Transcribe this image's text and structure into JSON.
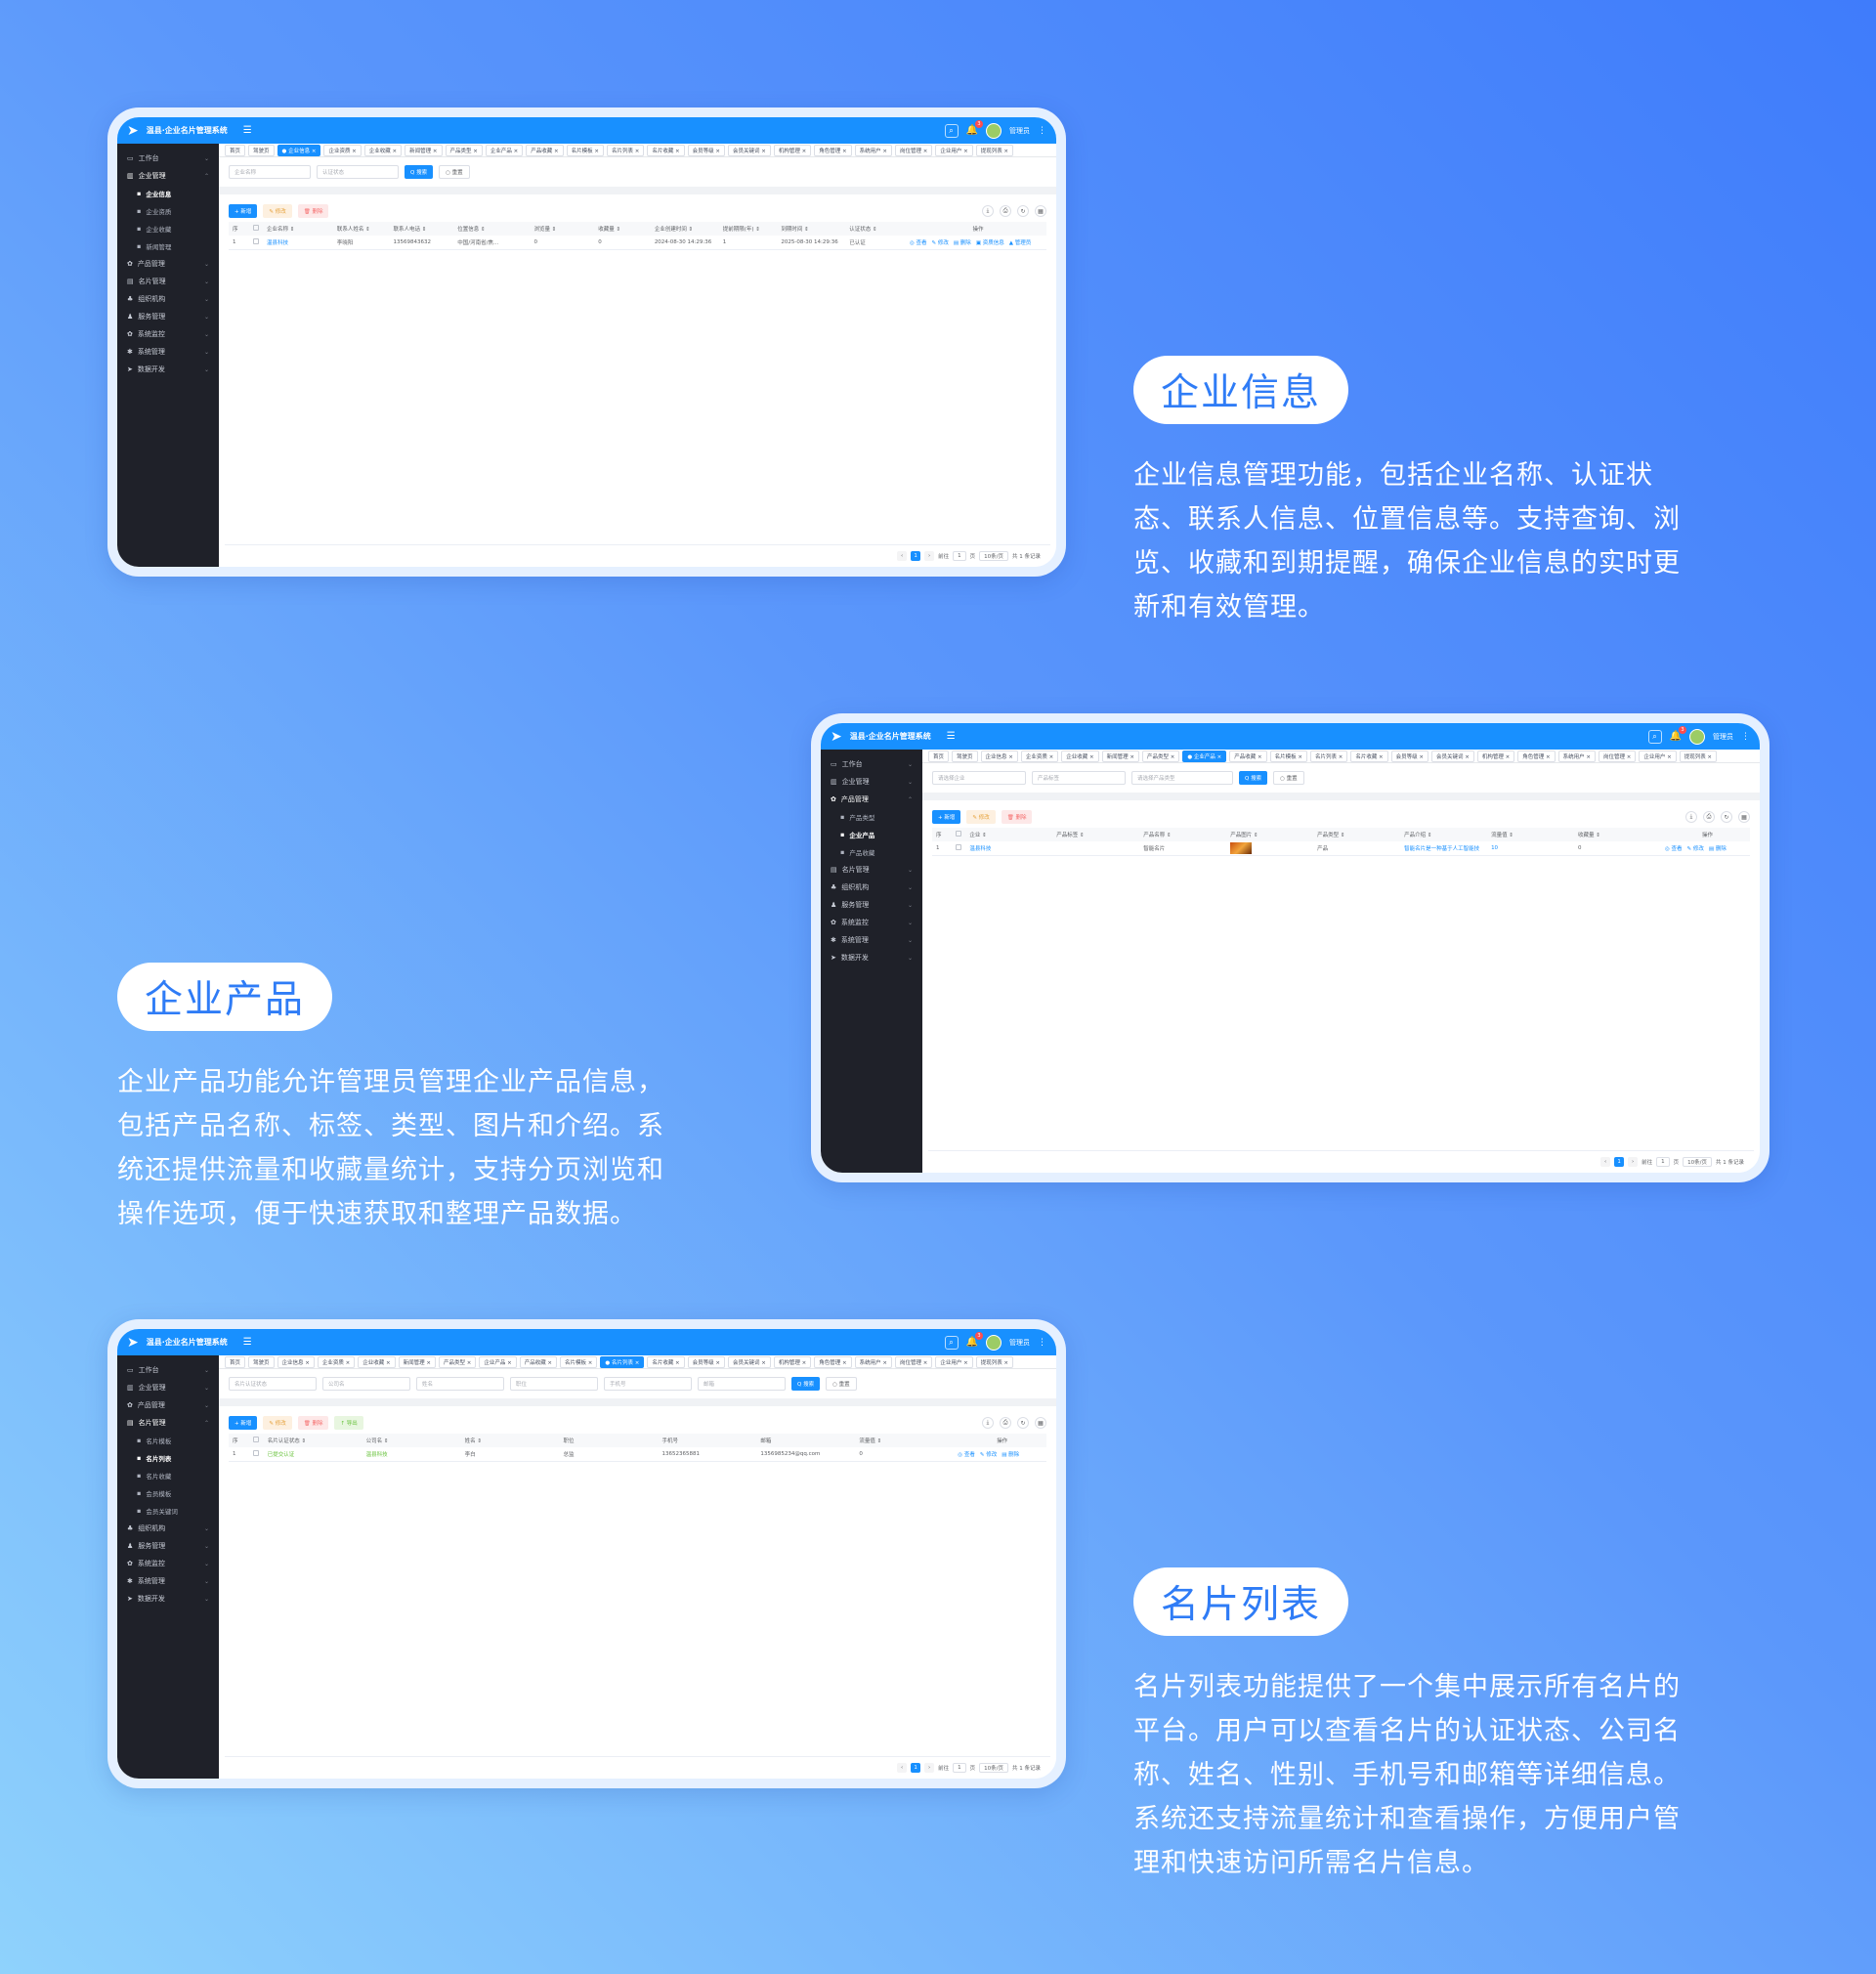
{
  "app": {
    "system_name": "温县·企业名片管理系统",
    "user_name": "管理员",
    "notif_count": "3",
    "brand_color": "#1890ff",
    "sidebar_color": "#1f2129"
  },
  "sections": [
    {
      "title": "企业信息",
      "description": "企业信息管理功能，包括企业名称、认证状态、联系人信息、位置信息等。支持查询、浏览、收藏和到期提醒，确保企业信息的实时更新和有效管理。"
    },
    {
      "title": "企业产品",
      "description": "企业产品功能允许管理员管理企业产品信息，包括产品名称、标签、类型、图片和介绍。系统还提供流量和收藏量统计，支持分页浏览和操作选项，便于快速获取和整理产品数据。"
    },
    {
      "title": "名片列表",
      "description": "名片列表功能提供了一个集中展示所有名片的平台。用户可以查看名片的认证状态、公司名称、姓名、性别、手机号和邮箱等详细信息。系统还支持流量统计和查看操作，方便用户管理和快速访问所需名片信息。"
    }
  ],
  "screens": [
    {
      "sidebar": [
        {
          "label": "工作台",
          "icon": "monitor-icon",
          "active": false
        },
        {
          "label": "企业管理",
          "icon": "building-icon",
          "active": true,
          "children": [
            {
              "label": "企业信息",
              "active": true
            },
            {
              "label": "企业资质",
              "active": false
            },
            {
              "label": "企业收藏",
              "active": false
            },
            {
              "label": "新闻管理",
              "active": false
            }
          ]
        },
        {
          "label": "产品管理",
          "icon": "gear-icon",
          "active": false
        },
        {
          "label": "名片管理",
          "icon": "card-icon",
          "active": false
        },
        {
          "label": "组织机构",
          "icon": "org-icon",
          "active": false
        },
        {
          "label": "服务管理",
          "icon": "service-icon",
          "active": false
        },
        {
          "label": "系统监控",
          "icon": "gear-icon",
          "active": false
        },
        {
          "label": "系统管理",
          "icon": "settings-icon",
          "active": false
        },
        {
          "label": "数据开发",
          "icon": "send-icon",
          "active": false
        }
      ],
      "tabs": [
        {
          "label": "首页",
          "active": false
        },
        {
          "label": "驾驶页",
          "active": false
        },
        {
          "label": "● 企业信息 ×",
          "active": true
        },
        {
          "label": "企业资质 ×",
          "active": false
        },
        {
          "label": "企业收藏 ×",
          "active": false
        },
        {
          "label": "新闻管理 ×",
          "active": false
        },
        {
          "label": "产品类型 ×",
          "active": false
        },
        {
          "label": "企业产品 ×",
          "active": false
        },
        {
          "label": "产品收藏 ×",
          "active": false
        },
        {
          "label": "名片模板 ×",
          "active": false
        },
        {
          "label": "名片列表 ×",
          "active": false
        },
        {
          "label": "名片收藏 ×",
          "active": false
        },
        {
          "label": "会员等级 ×",
          "active": false
        },
        {
          "label": "会员关键词 ×",
          "active": false
        },
        {
          "label": "机构管理 ×",
          "active": false
        },
        {
          "label": "角色管理 ×",
          "active": false
        },
        {
          "label": "系统用户 ×",
          "active": false
        },
        {
          "label": "岗位管理 ×",
          "active": false
        },
        {
          "label": "企业用户 ×",
          "active": false
        },
        {
          "label": "提现列表 ×",
          "active": false
        }
      ],
      "search_fields": [
        {
          "placeholder": "企业名称",
          "width": 84
        },
        {
          "placeholder": "认证状态",
          "width": 84
        }
      ],
      "search_label": "Q 搜索",
      "reset_label": "○ 重置",
      "toolbar_buttons": [
        {
          "label": "+ 新增",
          "kind": "add"
        },
        {
          "label": "✎ 修改",
          "kind": "warn"
        },
        {
          "label": "🗑 删除",
          "kind": "danger"
        }
      ],
      "columns": [
        {
          "label": "序",
          "w": 20
        },
        {
          "label": "",
          "w": 14,
          "check": true
        },
        {
          "label": "企业名称 ⇕",
          "w": 70
        },
        {
          "label": "联系人姓名 ⇕",
          "w": 56
        },
        {
          "label": "联系人电话 ⇕",
          "w": 64
        },
        {
          "label": "位置信息 ⇕",
          "w": 76
        },
        {
          "label": "浏览量 ⇕",
          "w": 64
        },
        {
          "label": "收藏量 ⇕",
          "w": 56
        },
        {
          "label": "企业创建时间 ⇕",
          "w": 68
        },
        {
          "label": "提前期限(年) ⇕",
          "w": 58
        },
        {
          "label": "到期时间 ⇕",
          "w": 68
        },
        {
          "label": "认证状态 ⇕",
          "w": 60
        },
        {
          "label": "操作",
          "w": 140,
          "center": true
        }
      ],
      "rows": [
        {
          "cells": [
            {
              "v": "1"
            },
            {
              "check": true
            },
            {
              "v": "温县科技",
              "cls": "link"
            },
            {
              "v": "李晓阳"
            },
            {
              "v": "13569843632"
            },
            {
              "v": "中国/河南省/焦..."
            },
            {
              "v": "0"
            },
            {
              "v": "0"
            },
            {
              "v": "2024-08-30 14:29:36"
            },
            {
              "v": "1"
            },
            {
              "v": "2025-08-30 14:29:36"
            },
            {
              "v": "已认证"
            },
            {
              "ops": [
                "◎ 查看",
                "✎ 修改",
                "▤ 删除",
                "▣ 资质信息",
                "▲ 管理员"
              ]
            }
          ]
        }
      ],
      "pager": {
        "current": "1",
        "goto_label": "前往",
        "goto_value": "1",
        "page_unit": "页",
        "page_size": "10条/页",
        "total": "共 1 条记录"
      }
    },
    {
      "sidebar": [
        {
          "label": "工作台",
          "icon": "monitor-icon",
          "active": false
        },
        {
          "label": "企业管理",
          "icon": "building-icon",
          "active": false
        },
        {
          "label": "产品管理",
          "icon": "gear-icon",
          "active": true,
          "children": [
            {
              "label": "产品类型",
              "active": false
            },
            {
              "label": "企业产品",
              "active": true
            },
            {
              "label": "产品收藏",
              "active": false
            }
          ]
        },
        {
          "label": "名片管理",
          "icon": "card-icon",
          "active": false
        },
        {
          "label": "组织机构",
          "icon": "org-icon",
          "active": false
        },
        {
          "label": "服务管理",
          "icon": "service-icon",
          "active": false
        },
        {
          "label": "系统监控",
          "icon": "gear-icon",
          "active": false
        },
        {
          "label": "系统管理",
          "icon": "settings-icon",
          "active": false
        },
        {
          "label": "数据开发",
          "icon": "send-icon",
          "active": false
        }
      ],
      "tabs": [
        {
          "label": "首页",
          "active": false
        },
        {
          "label": "驾驶页",
          "active": false
        },
        {
          "label": "企业信息 ×",
          "active": false
        },
        {
          "label": "企业资质 ×",
          "active": false
        },
        {
          "label": "企业收藏 ×",
          "active": false
        },
        {
          "label": "新闻管理 ×",
          "active": false
        },
        {
          "label": "产品类型 ×",
          "active": false
        },
        {
          "label": "● 企业产品 ×",
          "active": true
        },
        {
          "label": "产品收藏 ×",
          "active": false
        },
        {
          "label": "名片模板 ×",
          "active": false
        },
        {
          "label": "名片列表 ×",
          "active": false
        },
        {
          "label": "名片收藏 ×",
          "active": false
        },
        {
          "label": "会员等级 ×",
          "active": false
        },
        {
          "label": "会员关键词 ×",
          "active": false
        },
        {
          "label": "机构管理 ×",
          "active": false
        },
        {
          "label": "角色管理 ×",
          "active": false
        },
        {
          "label": "系统用户 ×",
          "active": false
        },
        {
          "label": "岗位管理 ×",
          "active": false
        },
        {
          "label": "企业用户 ×",
          "active": false
        },
        {
          "label": "提现列表 ×",
          "active": false
        }
      ],
      "search_fields": [
        {
          "placeholder": "请选择企业",
          "width": 96
        },
        {
          "placeholder": "产品标签",
          "width": 96
        },
        {
          "placeholder": "请选择产品类型",
          "width": 104
        }
      ],
      "search_label": "Q 搜索",
      "reset_label": "○ 重置",
      "toolbar_buttons": [
        {
          "label": "+ 新增",
          "kind": "add"
        },
        {
          "label": "✎ 修改",
          "kind": "warn"
        },
        {
          "label": "🗑 删除",
          "kind": "danger"
        }
      ],
      "columns": [
        {
          "label": "序",
          "w": 20
        },
        {
          "label": "",
          "w": 14,
          "check": true
        },
        {
          "label": "企业 ⇕",
          "w": 88
        },
        {
          "label": "产品标签 ⇕",
          "w": 88
        },
        {
          "label": "产品名称 ⇕",
          "w": 88
        },
        {
          "label": "产品图片 ⇕",
          "w": 88
        },
        {
          "label": "产品类型 ⇕",
          "w": 88
        },
        {
          "label": "产品介绍 ⇕",
          "w": 88
        },
        {
          "label": "流量值 ⇕",
          "w": 88
        },
        {
          "label": "收藏量 ⇕",
          "w": 88
        },
        {
          "label": "操作",
          "w": 90,
          "center": true
        }
      ],
      "rows": [
        {
          "cells": [
            {
              "v": "1"
            },
            {
              "check": true
            },
            {
              "v": "温县科技",
              "cls": "link"
            },
            {
              "v": ""
            },
            {
              "v": "智能名片"
            },
            {
              "thumb": true
            },
            {
              "v": "产品"
            },
            {
              "v": "智能名片是一种基于人工智能技",
              "cls": "link"
            },
            {
              "v": "10",
              "cls": "link"
            },
            {
              "v": "0"
            },
            {
              "ops": [
                "◎ 查看",
                "✎ 修改",
                "▤ 删除"
              ]
            }
          ]
        }
      ],
      "pager": {
        "current": "1",
        "goto_label": "前往",
        "goto_value": "1",
        "page_unit": "页",
        "page_size": "10条/页",
        "total": "共 1 条记录"
      }
    },
    {
      "sidebar": [
        {
          "label": "工作台",
          "icon": "monitor-icon",
          "active": false
        },
        {
          "label": "企业管理",
          "icon": "building-icon",
          "active": false
        },
        {
          "label": "产品管理",
          "icon": "gear-icon",
          "active": false
        },
        {
          "label": "名片管理",
          "icon": "card-icon",
          "active": true,
          "children": [
            {
              "label": "名片模板",
              "active": false
            },
            {
              "label": "名片列表",
              "active": true
            },
            {
              "label": "名片收藏",
              "active": false
            },
            {
              "label": "会员模板",
              "active": false
            },
            {
              "label": "会员关键词",
              "active": false
            }
          ]
        },
        {
          "label": "组织机构",
          "icon": "org-icon",
          "active": false
        },
        {
          "label": "服务管理",
          "icon": "service-icon",
          "active": false
        },
        {
          "label": "系统监控",
          "icon": "gear-icon",
          "active": false
        },
        {
          "label": "系统管理",
          "icon": "settings-icon",
          "active": false
        },
        {
          "label": "数据开发",
          "icon": "send-icon",
          "active": false
        }
      ],
      "tabs": [
        {
          "label": "首页",
          "active": false
        },
        {
          "label": "驾驶页",
          "active": false
        },
        {
          "label": "企业信息 ×",
          "active": false
        },
        {
          "label": "企业资质 ×",
          "active": false
        },
        {
          "label": "企业收藏 ×",
          "active": false
        },
        {
          "label": "新闻管理 ×",
          "active": false
        },
        {
          "label": "产品类型 ×",
          "active": false
        },
        {
          "label": "企业产品 ×",
          "active": false
        },
        {
          "label": "产品收藏 ×",
          "active": false
        },
        {
          "label": "名片模板 ×",
          "active": false
        },
        {
          "label": "● 名片列表 ×",
          "active": true
        },
        {
          "label": "名片收藏 ×",
          "active": false
        },
        {
          "label": "会员等级 ×",
          "active": false
        },
        {
          "label": "会员关键词 ×",
          "active": false
        },
        {
          "label": "机构管理 ×",
          "active": false
        },
        {
          "label": "角色管理 ×",
          "active": false
        },
        {
          "label": "系统用户 ×",
          "active": false
        },
        {
          "label": "岗位管理 ×",
          "active": false
        },
        {
          "label": "企业用户 ×",
          "active": false
        },
        {
          "label": "提现列表 ×",
          "active": false
        }
      ],
      "search_fields": [
        {
          "placeholder": "名片认证状态",
          "width": 90
        },
        {
          "placeholder": "公司名",
          "width": 90
        },
        {
          "placeholder": "姓名",
          "width": 90
        },
        {
          "placeholder": "职位",
          "width": 90
        },
        {
          "placeholder": "手机号",
          "width": 90
        },
        {
          "placeholder": "邮箱",
          "width": 90
        }
      ],
      "search_label": "Q 搜索",
      "reset_label": "○ 重置",
      "toolbar_buttons": [
        {
          "label": "+ 新增",
          "kind": "add"
        },
        {
          "label": "✎ 修改",
          "kind": "warn"
        },
        {
          "label": "🗑 删除",
          "kind": "danger"
        },
        {
          "label": "↑ 导出",
          "kind": "success"
        }
      ],
      "columns": [
        {
          "label": "序",
          "w": 20
        },
        {
          "label": "",
          "w": 14,
          "check": true
        },
        {
          "label": "名片认证状态 ⇕",
          "w": 96
        },
        {
          "label": "公司名 ⇕",
          "w": 96
        },
        {
          "label": "姓名 ⇕",
          "w": 96
        },
        {
          "label": "职位",
          "w": 96
        },
        {
          "label": "手机号",
          "w": 96
        },
        {
          "label": "邮箱",
          "w": 96
        },
        {
          "label": "流量值 ⇕",
          "w": 96
        },
        {
          "label": "操作",
          "w": 90,
          "center": true
        }
      ],
      "rows": [
        {
          "cells": [
            {
              "v": "1"
            },
            {
              "check": true
            },
            {
              "v": "已提交认证",
              "cls": "green"
            },
            {
              "v": "温县科技",
              "cls": "green"
            },
            {
              "v": "李白"
            },
            {
              "v": "总监"
            },
            {
              "v": "13652365881"
            },
            {
              "v": "1356985234@qq.com"
            },
            {
              "v": "0"
            },
            {
              "ops": [
                "◎ 查看",
                "✎ 修改",
                "▤ 删除"
              ]
            }
          ]
        }
      ],
      "pager": {
        "current": "1",
        "goto_label": "前往",
        "goto_value": "1",
        "page_unit": "页",
        "page_size": "10条/页",
        "total": "共 1 条记录"
      }
    }
  ]
}
